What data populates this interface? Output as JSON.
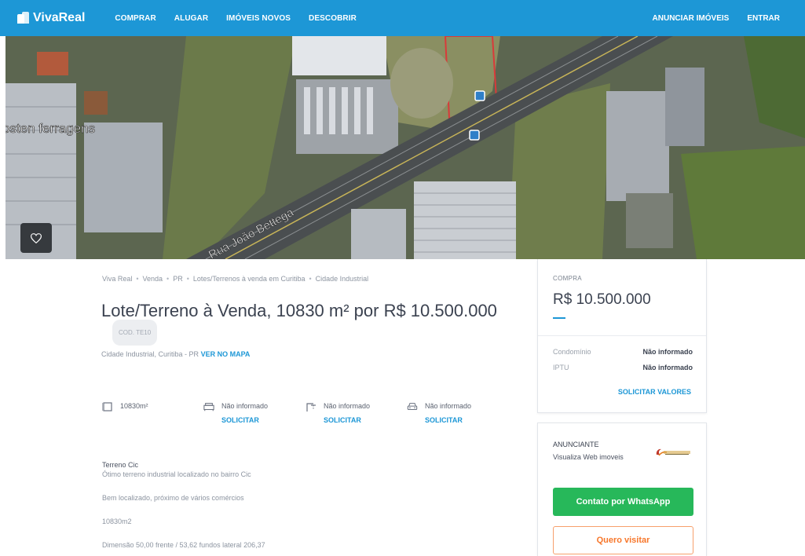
{
  "header": {
    "brand": "VivaReal",
    "nav": [
      "COMPRAR",
      "ALUGAR",
      "IMÓVEIS NOVOS",
      "DESCOBRIR"
    ],
    "nav_right": [
      "ANUNCIAR IMÓVEIS",
      "ENTRAR"
    ]
  },
  "map": {
    "label_business": "osten ferragens",
    "label_street": "Rua João Bettega"
  },
  "breadcrumb": [
    "Viva Real",
    "Venda",
    "PR",
    "Lotes/Terrenos à venda em Curitiba",
    "Cidade Industrial"
  ],
  "listing": {
    "title": "Lote/Terreno à Venda, 10830 m² por R$ 10.500.000",
    "code": "COD. TE10",
    "address": "Cidade Industrial, Curitiba - PR",
    "map_link": "VER NO MAPA"
  },
  "amenities": [
    {
      "icon": "area-icon",
      "value": "10830m²",
      "action": ""
    },
    {
      "icon": "bed-icon",
      "value": "Não informado",
      "action": "SOLICITAR"
    },
    {
      "icon": "shower-icon",
      "value": "Não informado",
      "action": "SOLICITAR"
    },
    {
      "icon": "car-icon",
      "value": "Não informado",
      "action": "SOLICITAR"
    }
  ],
  "description": {
    "heading": "Terreno Cic",
    "lines": [
      "Ótimo terreno industrial localizado no bairro Cic",
      "Bem localizado, próximo de vários comércios",
      "10830m2",
      "Dimensão 50,00 frente / 53,62 fundos lateral 206,37"
    ]
  },
  "price_card": {
    "label": "COMPRA",
    "price": "R$ 10.500.000",
    "condominio_label": "Condomínio",
    "condominio_value": "Não informado",
    "iptu_label": "IPTU",
    "iptu_value": "Não informado",
    "request_link": "SOLICITAR VALORES"
  },
  "advertiser": {
    "label": "ANUNCIANTE",
    "name": "Visualiza Web imoveis",
    "whatsapp_button": "Contato por WhatsApp",
    "visit_button": "Quero visitar"
  },
  "colors": {
    "brand": "#1d97d6",
    "whatsapp": "#27b85a",
    "visit": "#f7772b"
  }
}
